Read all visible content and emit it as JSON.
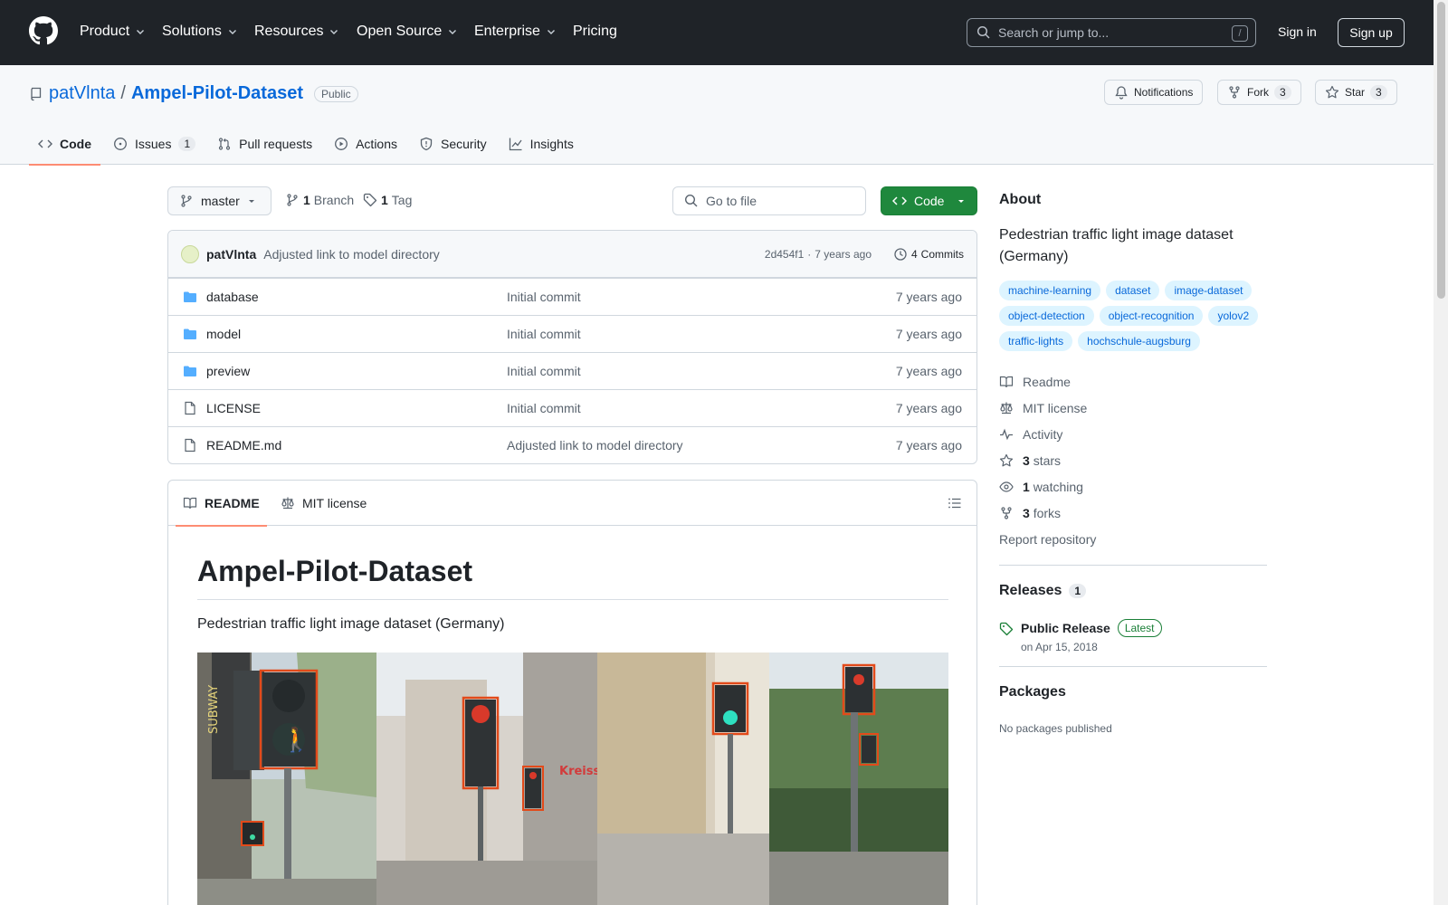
{
  "header": {
    "nav": [
      "Product",
      "Solutions",
      "Resources",
      "Open Source",
      "Enterprise",
      "Pricing"
    ],
    "search_placeholder": "Search or jump to...",
    "search_shortcut": "/",
    "sign_in": "Sign in",
    "sign_up": "Sign up"
  },
  "repo": {
    "owner": "patVlnta",
    "separator": "/",
    "name": "Ampel-Pilot-Dataset",
    "visibility": "Public",
    "notifications_label": "Notifications",
    "fork_label": "Fork",
    "fork_count": "3",
    "star_label": "Star",
    "star_count": "3"
  },
  "tabs": [
    {
      "label": "Code",
      "icon": "code-icon",
      "selected": true
    },
    {
      "label": "Issues",
      "icon": "issue-icon",
      "count": "1"
    },
    {
      "label": "Pull requests",
      "icon": "pull-request-icon"
    },
    {
      "label": "Actions",
      "icon": "play-icon"
    },
    {
      "label": "Security",
      "icon": "shield-icon"
    },
    {
      "label": "Insights",
      "icon": "graph-icon"
    }
  ],
  "toolbar": {
    "branch": "master",
    "branch_count": "1",
    "branch_label": "Branch",
    "tag_count": "1",
    "tag_label": "Tag",
    "go_to_file": "Go to file",
    "code_button": "Code"
  },
  "commit": {
    "author": "patVlnta",
    "message": "Adjusted link to model directory",
    "hash": "2d454f1",
    "dot": "·",
    "age": "7 years ago",
    "commits_count": "4",
    "commits_label": "Commits"
  },
  "files": [
    {
      "name": "database",
      "type": "folder",
      "message": "Initial commit",
      "date": "7 years ago"
    },
    {
      "name": "model",
      "type": "folder",
      "message": "Initial commit",
      "date": "7 years ago"
    },
    {
      "name": "preview",
      "type": "folder",
      "message": "Initial commit",
      "date": "7 years ago"
    },
    {
      "name": "LICENSE",
      "type": "file",
      "message": "Initial commit",
      "date": "7 years ago"
    },
    {
      "name": "README.md",
      "type": "file",
      "message": "Adjusted link to model directory",
      "date": "7 years ago"
    }
  ],
  "readme": {
    "tab_readme": "README",
    "tab_license": "MIT license",
    "title": "Ampel-Pilot-Dataset",
    "description": "Pedestrian traffic light image dataset (Germany)",
    "preview_text": [
      "SUBWAY",
      "Kreiss"
    ]
  },
  "about": {
    "heading": "About",
    "description": "Pedestrian traffic light image dataset (Germany)",
    "topics": [
      "machine-learning",
      "dataset",
      "image-dataset",
      "object-detection",
      "object-recognition",
      "yolov2",
      "traffic-lights",
      "hochschule-augsburg"
    ],
    "links": [
      {
        "icon": "book-icon",
        "text": "Readme"
      },
      {
        "icon": "law-icon",
        "text": "MIT license"
      },
      {
        "icon": "pulse-icon",
        "text": "Activity"
      },
      {
        "icon": "star-icon",
        "bold": "3",
        "text": "stars"
      },
      {
        "icon": "eye-icon",
        "bold": "1",
        "text": "watching"
      },
      {
        "icon": "fork-icon",
        "bold": "3",
        "text": "forks"
      }
    ],
    "report": "Report repository"
  },
  "releases": {
    "heading": "Releases",
    "count": "1",
    "name": "Public Release",
    "badge": "Latest",
    "date": "on Apr 15, 2018"
  },
  "packages": {
    "heading": "Packages",
    "empty": "No packages published"
  },
  "colors": {
    "header_bg": "#1f2328",
    "link": "#0969da",
    "primary_button": "#1f883d",
    "tab_underline": "#fd8c73",
    "topic_bg": "#ddf4ff"
  }
}
